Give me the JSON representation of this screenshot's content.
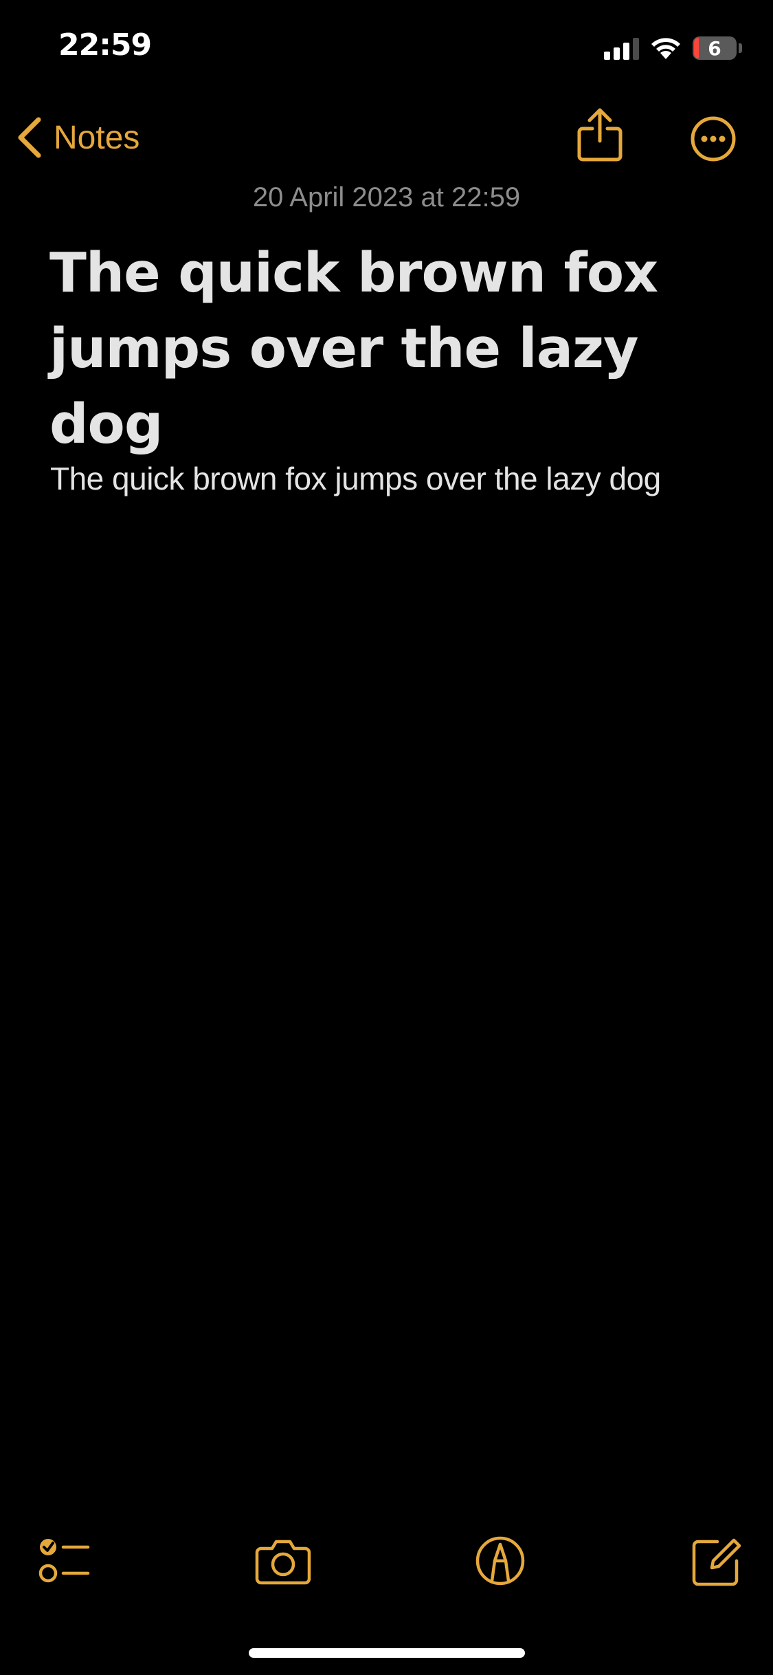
{
  "status_bar": {
    "time": "22:59",
    "battery_level": "6",
    "signal_bars": 3,
    "signal_bars_total": 4,
    "wifi_icon": "wifi-icon"
  },
  "nav": {
    "back_label": "Notes",
    "back_icon": "chevron-left-icon",
    "share_icon": "share-icon",
    "more_icon": "ellipsis-circle-icon"
  },
  "note": {
    "date": "20 April 2023 at 22:59",
    "title": "The quick brown fox jumps over the lazy dog",
    "body": "The quick brown fox jumps over the lazy dog"
  },
  "toolbar": {
    "checklist_icon": "checklist-icon",
    "camera_icon": "camera-icon",
    "markup_icon": "markup-pen-icon",
    "compose_icon": "compose-icon"
  },
  "colors": {
    "accent": "#e5a83b",
    "background": "#000000",
    "text": "#e4e4e4",
    "secondary_text": "#8d8d8d",
    "battery_low": "#ff453a"
  }
}
